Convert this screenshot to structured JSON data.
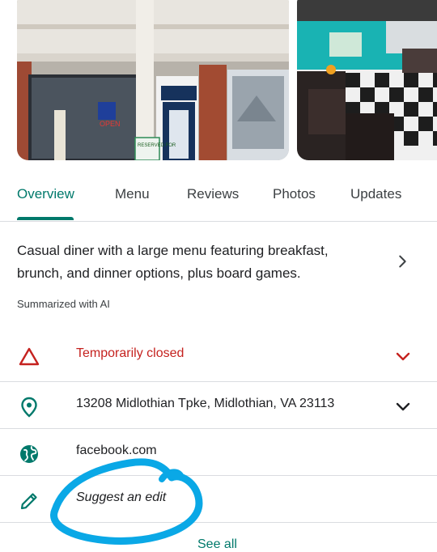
{
  "photos": {
    "photo1_sign": "RESERVED FOR",
    "photo1_window_sign": "OPEN"
  },
  "tabs": [
    {
      "label": "Overview",
      "active": true
    },
    {
      "label": "Menu",
      "active": false
    },
    {
      "label": "Reviews",
      "active": false
    },
    {
      "label": "Photos",
      "active": false
    },
    {
      "label": "Updates",
      "active": false
    }
  ],
  "summary": {
    "text": "Casual diner with a large menu featuring breakfast, brunch, and dinner options, plus board games.",
    "note": "Summarized with AI"
  },
  "info": {
    "status": "Temporarily closed",
    "address": "13208 Midlothian Tpke, Midlothian, VA 23113",
    "website": "facebook.com",
    "suggest_edit": "Suggest an edit",
    "see_all": "See all"
  },
  "colors": {
    "accent": "#00796b",
    "closed": "#c5221f",
    "annotation": "#0aa8e6"
  }
}
